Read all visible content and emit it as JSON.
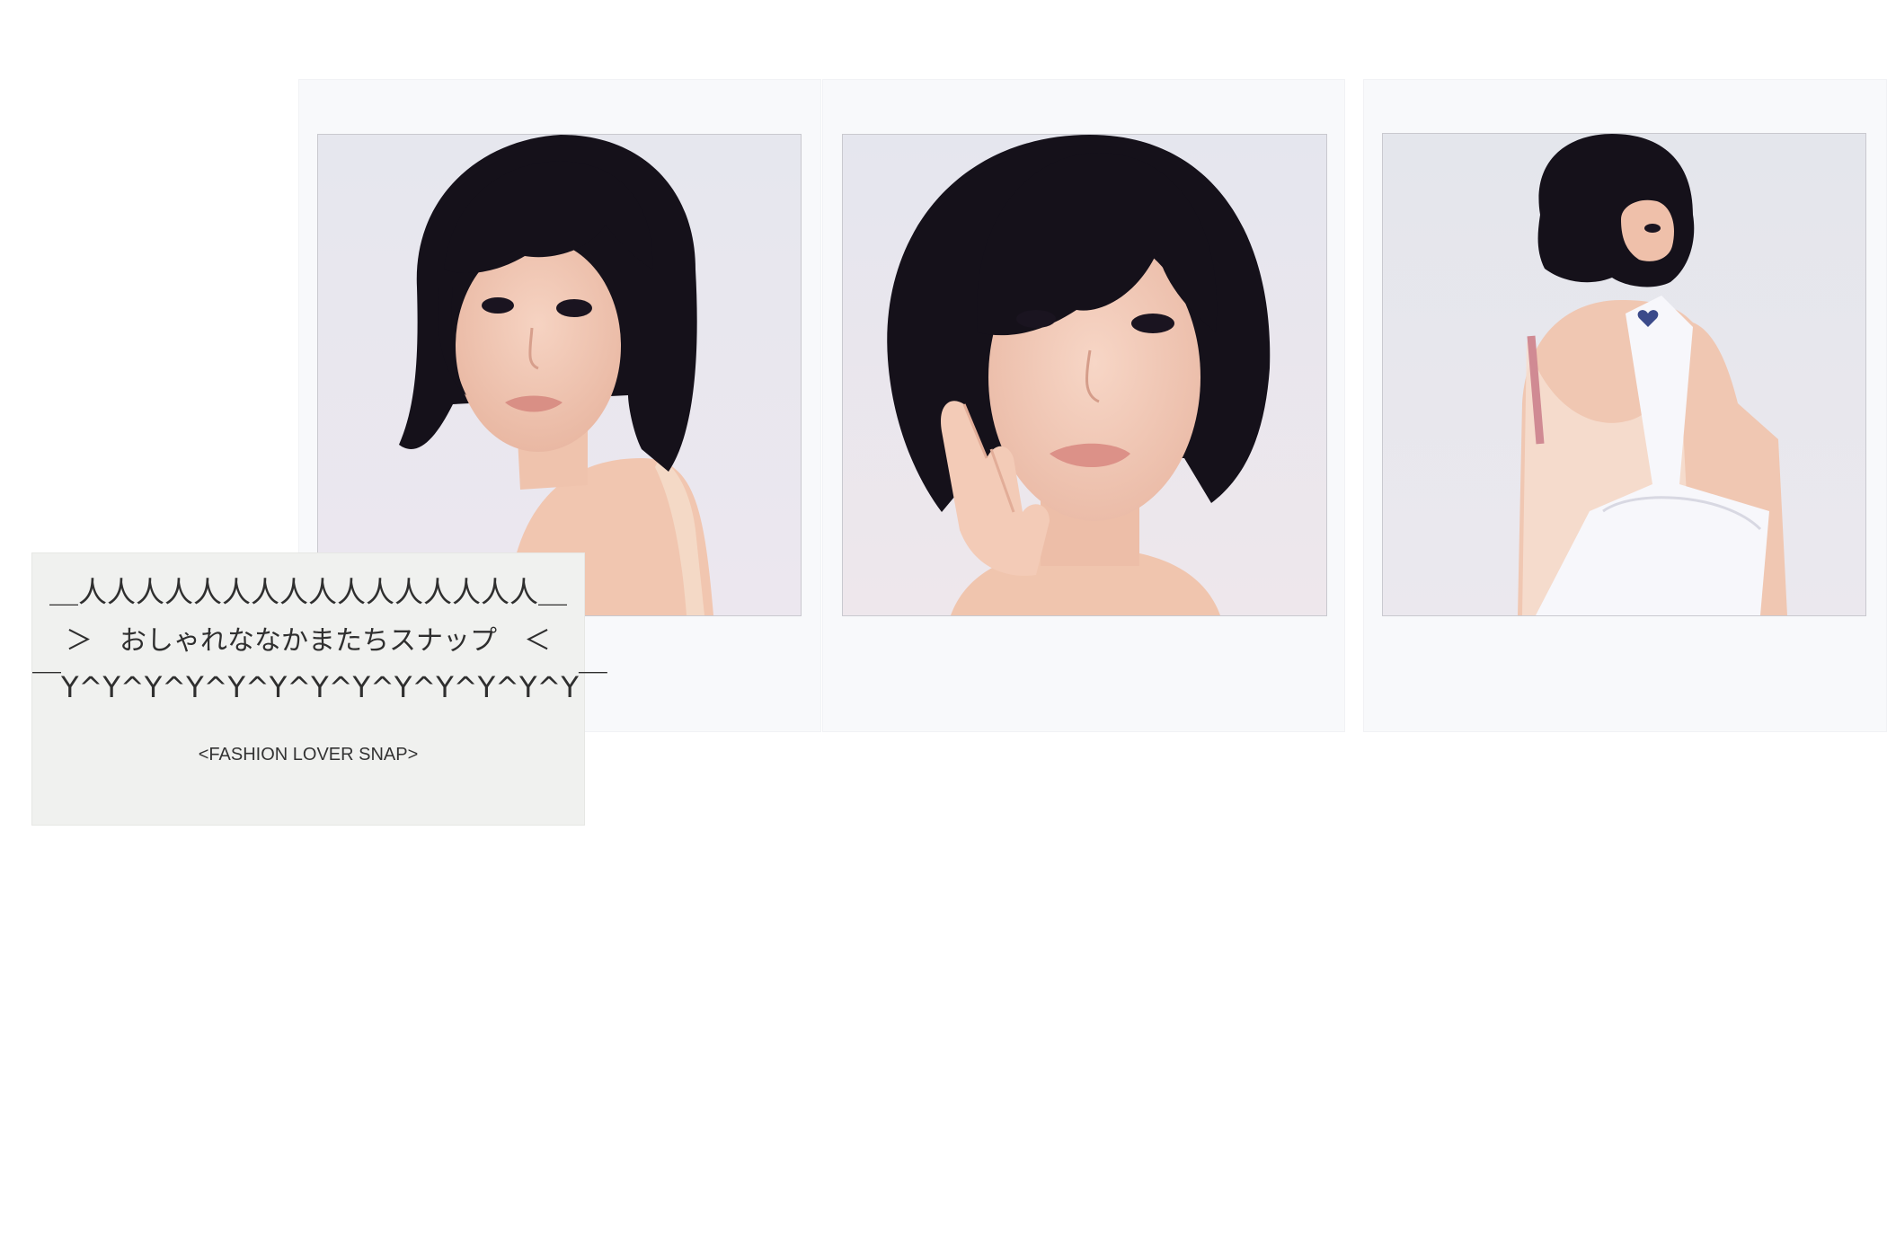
{
  "gallery": {
    "photos": [
      {
        "icon": "portrait-photo-icon",
        "subject": "woman-looking-over-shoulder"
      },
      {
        "icon": "portrait-photo-icon",
        "subject": "woman-hand-on-cheek"
      },
      {
        "icon": "portrait-photo-icon",
        "subject": "woman-back-view-with-bag"
      }
    ]
  },
  "note_card": {
    "ascii_top": "＿人人人人人人人人人人人人人人人人＿",
    "ascii_middle": "＞　おしゃれななかまたちスナップ　＜",
    "ascii_bottom": "￣Y^Y^Y^Y^Y^Y^Y^Y^Y^Y^Y^Y^Y￣",
    "caption": "<FASHION LOVER SNAP>"
  },
  "colors": {
    "hair": "#15111a",
    "skin": "#f2c9b4",
    "background": "#e7e8ee",
    "paper": "#f8f9fb"
  }
}
